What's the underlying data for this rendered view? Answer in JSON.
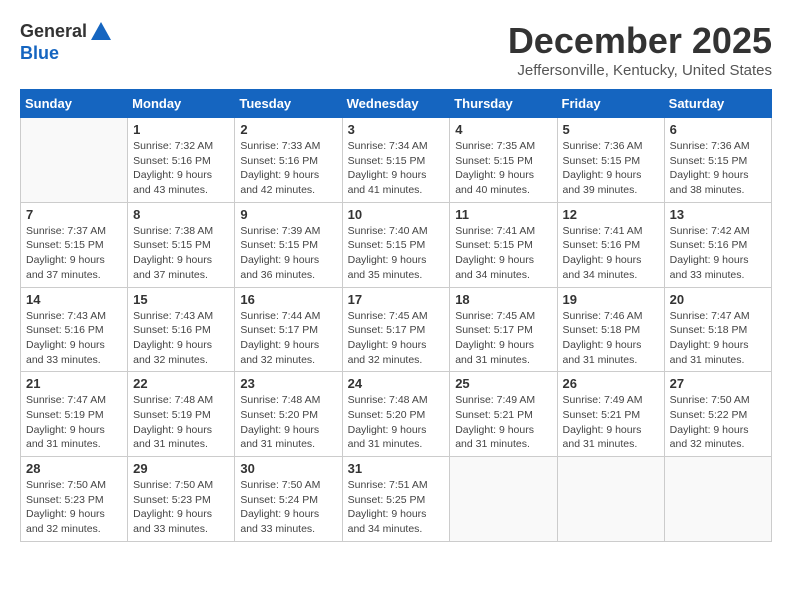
{
  "header": {
    "logo_general": "General",
    "logo_blue": "Blue",
    "month_title": "December 2025",
    "location": "Jeffersonville, Kentucky, United States"
  },
  "weekdays": [
    "Sunday",
    "Monday",
    "Tuesday",
    "Wednesday",
    "Thursday",
    "Friday",
    "Saturday"
  ],
  "weeks": [
    [
      {
        "day": "",
        "sunrise": "",
        "sunset": "",
        "daylight": ""
      },
      {
        "day": "1",
        "sunrise": "Sunrise: 7:32 AM",
        "sunset": "Sunset: 5:16 PM",
        "daylight": "Daylight: 9 hours and 43 minutes."
      },
      {
        "day": "2",
        "sunrise": "Sunrise: 7:33 AM",
        "sunset": "Sunset: 5:16 PM",
        "daylight": "Daylight: 9 hours and 42 minutes."
      },
      {
        "day": "3",
        "sunrise": "Sunrise: 7:34 AM",
        "sunset": "Sunset: 5:15 PM",
        "daylight": "Daylight: 9 hours and 41 minutes."
      },
      {
        "day": "4",
        "sunrise": "Sunrise: 7:35 AM",
        "sunset": "Sunset: 5:15 PM",
        "daylight": "Daylight: 9 hours and 40 minutes."
      },
      {
        "day": "5",
        "sunrise": "Sunrise: 7:36 AM",
        "sunset": "Sunset: 5:15 PM",
        "daylight": "Daylight: 9 hours and 39 minutes."
      },
      {
        "day": "6",
        "sunrise": "Sunrise: 7:36 AM",
        "sunset": "Sunset: 5:15 PM",
        "daylight": "Daylight: 9 hours and 38 minutes."
      }
    ],
    [
      {
        "day": "7",
        "sunrise": "Sunrise: 7:37 AM",
        "sunset": "Sunset: 5:15 PM",
        "daylight": "Daylight: 9 hours and 37 minutes."
      },
      {
        "day": "8",
        "sunrise": "Sunrise: 7:38 AM",
        "sunset": "Sunset: 5:15 PM",
        "daylight": "Daylight: 9 hours and 37 minutes."
      },
      {
        "day": "9",
        "sunrise": "Sunrise: 7:39 AM",
        "sunset": "Sunset: 5:15 PM",
        "daylight": "Daylight: 9 hours and 36 minutes."
      },
      {
        "day": "10",
        "sunrise": "Sunrise: 7:40 AM",
        "sunset": "Sunset: 5:15 PM",
        "daylight": "Daylight: 9 hours and 35 minutes."
      },
      {
        "day": "11",
        "sunrise": "Sunrise: 7:41 AM",
        "sunset": "Sunset: 5:15 PM",
        "daylight": "Daylight: 9 hours and 34 minutes."
      },
      {
        "day": "12",
        "sunrise": "Sunrise: 7:41 AM",
        "sunset": "Sunset: 5:16 PM",
        "daylight": "Daylight: 9 hours and 34 minutes."
      },
      {
        "day": "13",
        "sunrise": "Sunrise: 7:42 AM",
        "sunset": "Sunset: 5:16 PM",
        "daylight": "Daylight: 9 hours and 33 minutes."
      }
    ],
    [
      {
        "day": "14",
        "sunrise": "Sunrise: 7:43 AM",
        "sunset": "Sunset: 5:16 PM",
        "daylight": "Daylight: 9 hours and 33 minutes."
      },
      {
        "day": "15",
        "sunrise": "Sunrise: 7:43 AM",
        "sunset": "Sunset: 5:16 PM",
        "daylight": "Daylight: 9 hours and 32 minutes."
      },
      {
        "day": "16",
        "sunrise": "Sunrise: 7:44 AM",
        "sunset": "Sunset: 5:17 PM",
        "daylight": "Daylight: 9 hours and 32 minutes."
      },
      {
        "day": "17",
        "sunrise": "Sunrise: 7:45 AM",
        "sunset": "Sunset: 5:17 PM",
        "daylight": "Daylight: 9 hours and 32 minutes."
      },
      {
        "day": "18",
        "sunrise": "Sunrise: 7:45 AM",
        "sunset": "Sunset: 5:17 PM",
        "daylight": "Daylight: 9 hours and 31 minutes."
      },
      {
        "day": "19",
        "sunrise": "Sunrise: 7:46 AM",
        "sunset": "Sunset: 5:18 PM",
        "daylight": "Daylight: 9 hours and 31 minutes."
      },
      {
        "day": "20",
        "sunrise": "Sunrise: 7:47 AM",
        "sunset": "Sunset: 5:18 PM",
        "daylight": "Daylight: 9 hours and 31 minutes."
      }
    ],
    [
      {
        "day": "21",
        "sunrise": "Sunrise: 7:47 AM",
        "sunset": "Sunset: 5:19 PM",
        "daylight": "Daylight: 9 hours and 31 minutes."
      },
      {
        "day": "22",
        "sunrise": "Sunrise: 7:48 AM",
        "sunset": "Sunset: 5:19 PM",
        "daylight": "Daylight: 9 hours and 31 minutes."
      },
      {
        "day": "23",
        "sunrise": "Sunrise: 7:48 AM",
        "sunset": "Sunset: 5:20 PM",
        "daylight": "Daylight: 9 hours and 31 minutes."
      },
      {
        "day": "24",
        "sunrise": "Sunrise: 7:48 AM",
        "sunset": "Sunset: 5:20 PM",
        "daylight": "Daylight: 9 hours and 31 minutes."
      },
      {
        "day": "25",
        "sunrise": "Sunrise: 7:49 AM",
        "sunset": "Sunset: 5:21 PM",
        "daylight": "Daylight: 9 hours and 31 minutes."
      },
      {
        "day": "26",
        "sunrise": "Sunrise: 7:49 AM",
        "sunset": "Sunset: 5:21 PM",
        "daylight": "Daylight: 9 hours and 31 minutes."
      },
      {
        "day": "27",
        "sunrise": "Sunrise: 7:50 AM",
        "sunset": "Sunset: 5:22 PM",
        "daylight": "Daylight: 9 hours and 32 minutes."
      }
    ],
    [
      {
        "day": "28",
        "sunrise": "Sunrise: 7:50 AM",
        "sunset": "Sunset: 5:23 PM",
        "daylight": "Daylight: 9 hours and 32 minutes."
      },
      {
        "day": "29",
        "sunrise": "Sunrise: 7:50 AM",
        "sunset": "Sunset: 5:23 PM",
        "daylight": "Daylight: 9 hours and 33 minutes."
      },
      {
        "day": "30",
        "sunrise": "Sunrise: 7:50 AM",
        "sunset": "Sunset: 5:24 PM",
        "daylight": "Daylight: 9 hours and 33 minutes."
      },
      {
        "day": "31",
        "sunrise": "Sunrise: 7:51 AM",
        "sunset": "Sunset: 5:25 PM",
        "daylight": "Daylight: 9 hours and 34 minutes."
      },
      {
        "day": "",
        "sunrise": "",
        "sunset": "",
        "daylight": ""
      },
      {
        "day": "",
        "sunrise": "",
        "sunset": "",
        "daylight": ""
      },
      {
        "day": "",
        "sunrise": "",
        "sunset": "",
        "daylight": ""
      }
    ]
  ]
}
